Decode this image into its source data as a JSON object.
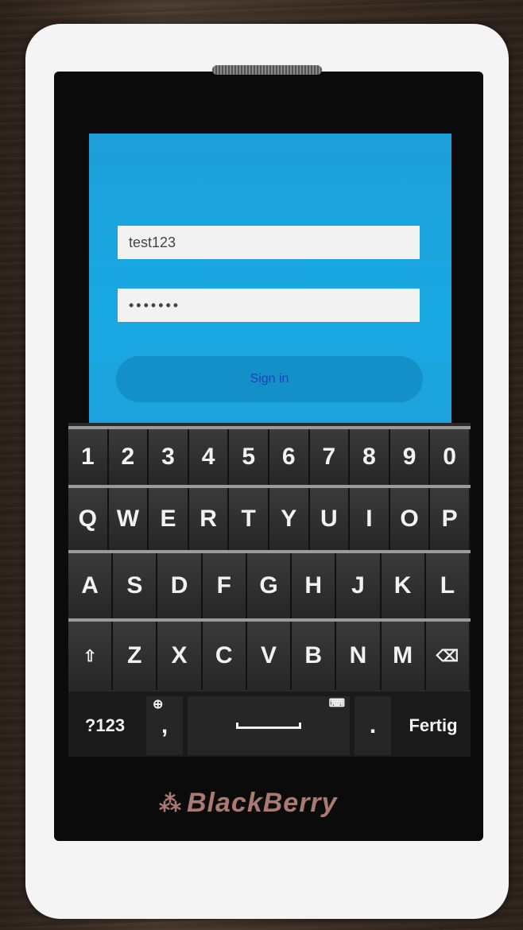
{
  "login": {
    "username_value": "test123",
    "password_value": "•••••••",
    "signin_label": "Sign in"
  },
  "keyboard": {
    "number_row": [
      "1",
      "2",
      "3",
      "4",
      "5",
      "6",
      "7",
      "8",
      "9",
      "0"
    ],
    "row1": [
      "Q",
      "W",
      "E",
      "R",
      "T",
      "Y",
      "U",
      "I",
      "O",
      "P"
    ],
    "row2": [
      "A",
      "S",
      "D",
      "F",
      "G",
      "H",
      "J",
      "K",
      "L"
    ],
    "row3": [
      "Z",
      "X",
      "C",
      "V",
      "B",
      "N",
      "M"
    ],
    "shift_glyph": "⇧",
    "backspace_glyph": "⌫",
    "symbols_label": "?123",
    "comma_label": ",",
    "globe_glyph": "⊕",
    "keyboard_glyph": "⌨",
    "period_label": ".",
    "done_label": "Fertig"
  },
  "device": {
    "brand": "BlackBerry",
    "brand_mark": "⁂"
  }
}
